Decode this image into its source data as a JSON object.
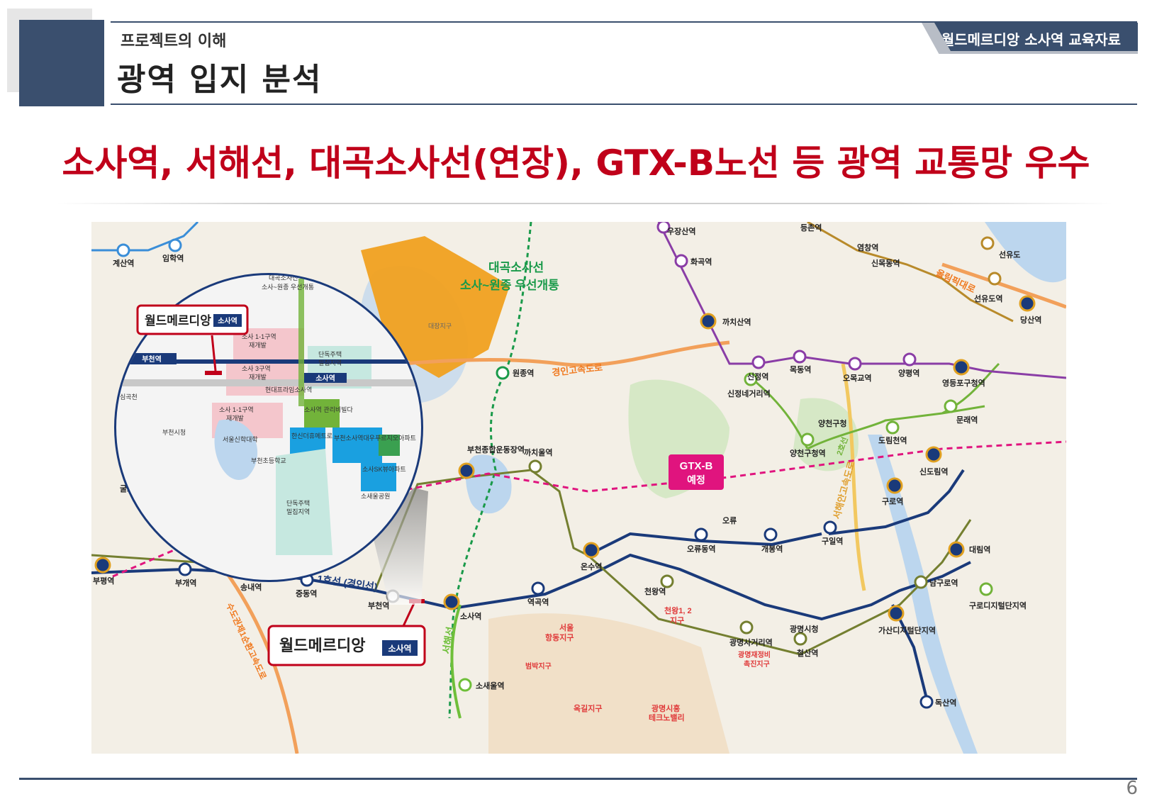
{
  "header": {
    "subtitle": "프로젝트의 이해",
    "title": "광역 입지 분석",
    "badge": "월드메르디앙 소사역 교육자료"
  },
  "headline": "소사역, 서해선, 대곡소사선(연장), GTX-B노선 등 광역 교통망 우수",
  "colors": {
    "navy": "#3a4f6e",
    "headline_red": "#c0001a",
    "line1_navy": "#1a3a7a",
    "line2_green": "#72b33a",
    "line7_olive": "#747f30",
    "line5_purple": "#8a3da6",
    "line9_gold": "#b88a2a",
    "line_blue": "#3a8ed8",
    "seohae_green": "#6fbf3a",
    "gtx_pink": "#e0147e",
    "daegok_green": "#1a9a4a",
    "development_orange": "#f0a020"
  },
  "map": {
    "line_names": {
      "line1": "1호선 (경인선)",
      "seohae": "서해선",
      "daegok": "대곡소사선",
      "gtx": "GTX-B 예정",
      "line2": "2호선",
      "gyeongin_highway": "경인고속도로",
      "seohae_highway": "서해안고속도로",
      "olympic": "올림픽대로",
      "outer_ring": "수도권제1순환고속도로"
    },
    "annotations": {
      "daegok_note_1": "대곡소사선",
      "daegok_note_2": "소사~원종 우선개통",
      "gtx_box_1": "GTX-B",
      "gtx_box_2": "예정",
      "brand": "월드메르디앙",
      "brand_tag": "소사역",
      "daejang": "대장지구",
      "cheonwang": "천왕1, 2",
      "cheonwang2": "지구",
      "gmeasure1": "광명재정비",
      "gmeasure2": "촉진지구",
      "okgil": "옥길지구",
      "bumbak": "범박지구",
      "hangdong1": "서울",
      "hangdong2": "항동지구",
      "gwangmyeong_tech1": "광명시흥",
      "gwangmyeong_tech2": "테크노밸리"
    },
    "stations": [
      "우장산역",
      "화곡역",
      "까치산역",
      "신정역",
      "목동역",
      "오목교역",
      "양평역",
      "영등포구청역",
      "등촌역",
      "염창역",
      "신목동역",
      "선유도",
      "선유도역",
      "당산역",
      "문래역",
      "도림천역",
      "양천구청역",
      "양천구청",
      "신정네거리역",
      "신도림역",
      "구로역",
      "구일역",
      "대림역",
      "남구로역",
      "구로디지털단지역",
      "가산디지털단지역",
      "독산역",
      "오류동역",
      "개봉역",
      "오류",
      "온수역",
      "천왕역",
      "광명사거리역",
      "광명시청",
      "철산역",
      "역곡역",
      "소사역",
      "부천역",
      "중동역",
      "송내역",
      "부개역",
      "부평역",
      "소새울역",
      "까치울역",
      "부천종합운동장역",
      "원종역",
      "계산역",
      "임학역",
      "굴포"
    ],
    "inset": {
      "labels": [
        "대곡소사선",
        "소사~원종 우선개통",
        "소사 1-1구역",
        "재개발",
        "소사 3구역",
        "재개발",
        "소사 1-1구역",
        "재개발",
        "부천역",
        "소사역",
        "단독주택",
        "밀집지역",
        "현대프라임소사역",
        "한신더휴메트로",
        "소사역 관리비빌다",
        "부천소사역대우푸르지오아파트",
        "소사SK뷰아파트",
        "소새울공원",
        "단독주택",
        "밀집지역",
        "심곡천",
        "서울신학대학",
        "부천시청",
        "부천초등학교"
      ]
    }
  },
  "footer": {
    "page": "6"
  }
}
